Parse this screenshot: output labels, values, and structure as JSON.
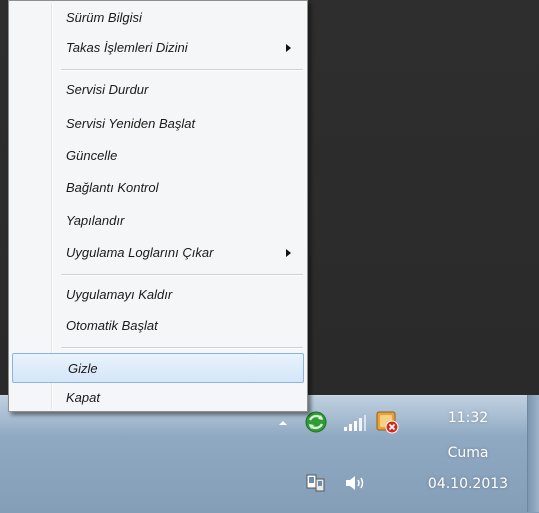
{
  "menu": {
    "items": [
      {
        "label": "Sürüm Bilgisi"
      },
      {
        "label": "Takas İşlemleri Dizini",
        "submenu": true
      },
      {
        "label": "Servisi Durdur"
      },
      {
        "label": "Servisi Yeniden Başlat"
      },
      {
        "label": "Güncelle"
      },
      {
        "label": "Bağlantı Kontrol"
      },
      {
        "label": "Yapılandır"
      },
      {
        "label": "Uygulama Loglarını Çıkar",
        "submenu": true
      },
      {
        "label": "Uygulamayı Kaldır"
      },
      {
        "label": "Otomatik Başlat"
      },
      {
        "label": "Gizle",
        "highlighted": true
      },
      {
        "label": "Kapat"
      }
    ]
  },
  "tray": {
    "icons": [
      "show-hidden-icons-arrow",
      "sync-app-icon",
      "signal-strength-icon",
      "action-center-icon",
      "network-icon",
      "volume-icon"
    ],
    "clock": {
      "time": "11:32",
      "day": "Cuma",
      "date": "04.10.2013"
    }
  },
  "colors": {
    "menu_bg": "#f5f6f7",
    "highlight": "#d4e6f8",
    "taskbar": "#8fa9c2",
    "desktop": "#2b2b2b"
  }
}
